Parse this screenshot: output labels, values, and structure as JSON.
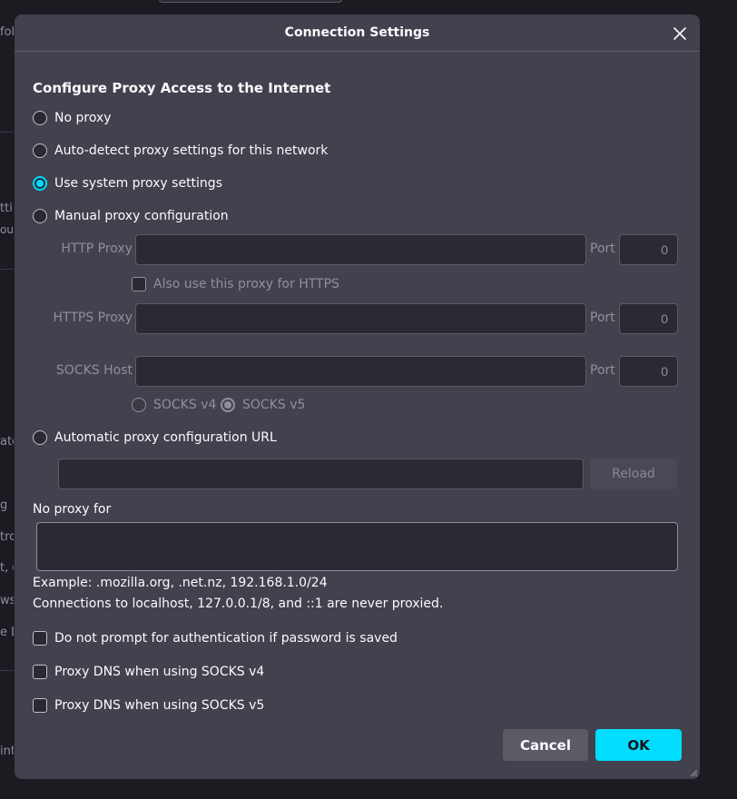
{
  "background": {
    "fragments": [
      "fol",
      "ttin",
      "out",
      "ate",
      "g",
      "tro",
      "t, c",
      "wse",
      "e L",
      "int"
    ]
  },
  "dialog": {
    "title": "Connection Settings",
    "heading": "Configure Proxy Access to the Internet",
    "options": {
      "no_proxy": "No proxy",
      "auto_detect": "Auto-detect proxy settings for this network",
      "system": "Use system proxy settings",
      "manual": "Manual proxy configuration",
      "auto_url": "Automatic proxy configuration URL"
    },
    "selected_option": "Use system proxy settings",
    "manual": {
      "http_label": "HTTP Proxy",
      "http_value": "",
      "also_https_label": "Also use this proxy for HTTPS",
      "https_label": "HTTPS Proxy",
      "https_value": "",
      "socks_label": "SOCKS Host",
      "socks_value": "",
      "port_label": "Port",
      "http_port": "0",
      "https_port": "0",
      "socks_port": "0",
      "socks_v4": "SOCKS v4",
      "socks_v5": "SOCKS v5"
    },
    "auto_url_value": "",
    "reload_label": "Reload",
    "no_proxy_for_label": "No proxy for",
    "no_proxy_for_value": "",
    "example_text": "Example: .mozilla.org, .net.nz, 192.168.1.0/24",
    "localhost_note": "Connections to localhost, 127.0.0.1/8, and ::1 are never proxied.",
    "checkboxes": {
      "no_prompt_auth": "Do not prompt for authentication if password is saved",
      "dns_socks4": "Proxy DNS when using SOCKS v4",
      "dns_socks5": "Proxy DNS when using SOCKS v5"
    },
    "cancel_label": "Cancel",
    "ok_label": "OK"
  },
  "colors": {
    "accent": "#00ddff",
    "dialog_bg": "#42414d",
    "page_bg": "#1c1b22"
  }
}
